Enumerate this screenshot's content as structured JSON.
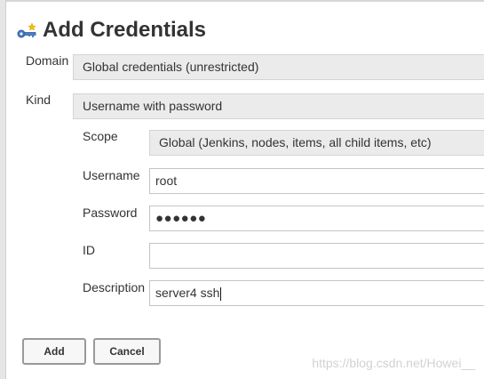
{
  "header": {
    "title": "Add Credentials",
    "icon": "credentials-key-icon"
  },
  "form": {
    "domain": {
      "label": "Domain",
      "value": "Global credentials (unrestricted)"
    },
    "kind": {
      "label": "Kind",
      "value": "Username with password"
    },
    "scope": {
      "label": "Scope",
      "value": "Global (Jenkins, nodes, items, all child items, etc)"
    },
    "username": {
      "label": "Username",
      "value": "root"
    },
    "password": {
      "label": "Password",
      "value": "●●●●●●"
    },
    "id": {
      "label": "ID",
      "value": ""
    },
    "description": {
      "label": "Description",
      "value": "server4 ssh"
    }
  },
  "buttons": {
    "add": "Add",
    "cancel": "Cancel"
  },
  "watermark": "https://blog.csdn.net/Howei__"
}
